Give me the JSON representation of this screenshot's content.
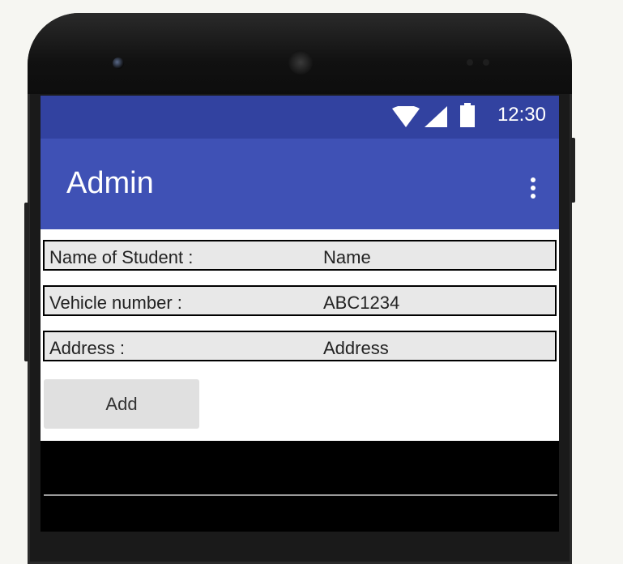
{
  "status_bar": {
    "time": "12:30",
    "icons": [
      "wifi-icon",
      "signal-icon",
      "battery-icon"
    ]
  },
  "app_bar": {
    "title": "Admin",
    "menu_icon": "more-vert-icon"
  },
  "form": {
    "rows": [
      {
        "label": "Name of Student :",
        "value": "Name"
      },
      {
        "label": "Vehicle number :",
        "value": "ABC1234"
      },
      {
        "label": "Address :",
        "value": "Address"
      }
    ],
    "add_button_label": "Add"
  },
  "colors": {
    "status_bar": "#3242a0",
    "app_bar": "#3f51b5",
    "row_background": "#e8e8e8",
    "button_background": "#e0e0e0"
  }
}
